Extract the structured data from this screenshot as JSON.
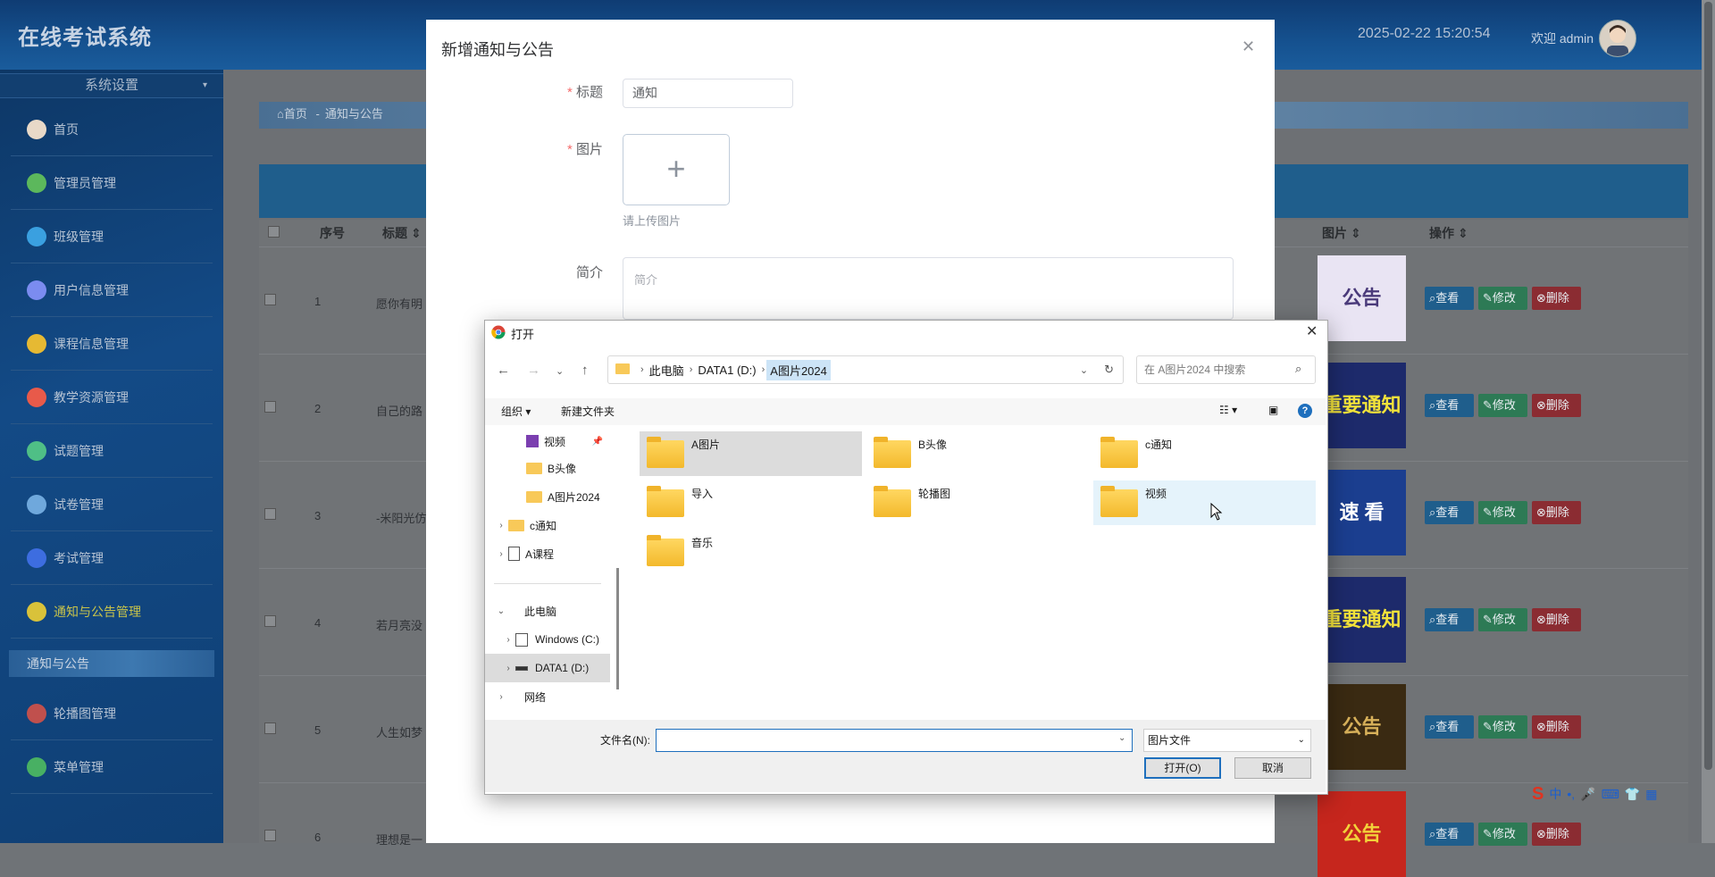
{
  "app": {
    "title": "在线考试系统",
    "datetime": "2025-02-22 15:20:54",
    "welcome": "欢迎 admin"
  },
  "sidebar": {
    "header": "系统设置",
    "items": [
      {
        "label": "首页",
        "color": "#e8d9c8"
      },
      {
        "label": "管理员管理",
        "color": "#5cb85c"
      },
      {
        "label": "班级管理",
        "color": "#3aa0e0"
      },
      {
        "label": "用户信息管理",
        "color": "#7b8cf0"
      },
      {
        "label": "课程信息管理",
        "color": "#e6b933"
      },
      {
        "label": "教学资源管理",
        "color": "#e85a4a"
      },
      {
        "label": "试题管理",
        "color": "#4fbf86"
      },
      {
        "label": "试卷管理",
        "color": "#6fa8dc"
      },
      {
        "label": "考试管理",
        "color": "#3d6de0"
      },
      {
        "label": "通知与公告管理",
        "color": "#d9c23a"
      },
      {
        "label": "轮播图管理",
        "color": "#c0504d"
      },
      {
        "label": "菜单管理",
        "color": "#48b063"
      }
    ],
    "active_sub": "通知与公告"
  },
  "breadcrumb": {
    "home": "首页",
    "sep": "-",
    "current": "通知与公告"
  },
  "table": {
    "headers": {
      "index": "序号",
      "title": "标题",
      "image": "图片",
      "actions": "操作"
    },
    "rows": [
      {
        "index": "1",
        "title": "愿你有明",
        "pic": "公告"
      },
      {
        "index": "2",
        "title": "自己的路",
        "pic": "重要通知"
      },
      {
        "index": "3",
        "title": "-米阳光仿",
        "pic": "速 看"
      },
      {
        "index": "4",
        "title": "若月亮没",
        "pic": "重要通知"
      },
      {
        "index": "5",
        "title": "人生如梦",
        "pic": "公告"
      },
      {
        "index": "6",
        "title": "理想是一",
        "pic": "公告"
      }
    ],
    "btn_view": "查看",
    "btn_edit": "修改",
    "btn_delete": "删除"
  },
  "dialog": {
    "title": "新增通知与公告",
    "fields": {
      "title_label": "标题",
      "title_value": "通知",
      "image_label": "图片",
      "image_tip": "请上传图片",
      "summary_label": "简介",
      "summary_placeholder": "简介"
    }
  },
  "open_dialog": {
    "title": "打开",
    "path": [
      "此电脑",
      "DATA1 (D:)",
      "A图片2024"
    ],
    "search_placeholder": "在 A图片2024 中搜索",
    "toolbar": {
      "organize": "组织",
      "new_folder": "新建文件夹"
    },
    "tree": [
      {
        "label": "视频",
        "type": "video",
        "pinned": true
      },
      {
        "label": "B头像",
        "type": "folder"
      },
      {
        "label": "A图片2024",
        "type": "folder"
      },
      {
        "label": "c通知",
        "type": "folder",
        "expand": true
      },
      {
        "label": "A课程",
        "type": "file",
        "expand": true
      },
      {
        "label": "此电脑",
        "type": "pc",
        "expanded": true
      },
      {
        "label": "Windows (C:)",
        "type": "drive",
        "expand": true
      },
      {
        "label": "DATA1 (D:)",
        "type": "drive",
        "expand": true,
        "selected": true
      },
      {
        "label": "网络",
        "type": "net",
        "expand": true
      }
    ],
    "files": [
      "A图片",
      "B头像",
      "c通知",
      "导入",
      "轮播图",
      "视频",
      "音乐"
    ],
    "filename_label": "文件名(N):",
    "filename_value": "",
    "filetype": "图片文件",
    "open_btn": "打开(O)",
    "cancel_btn": "取消"
  }
}
